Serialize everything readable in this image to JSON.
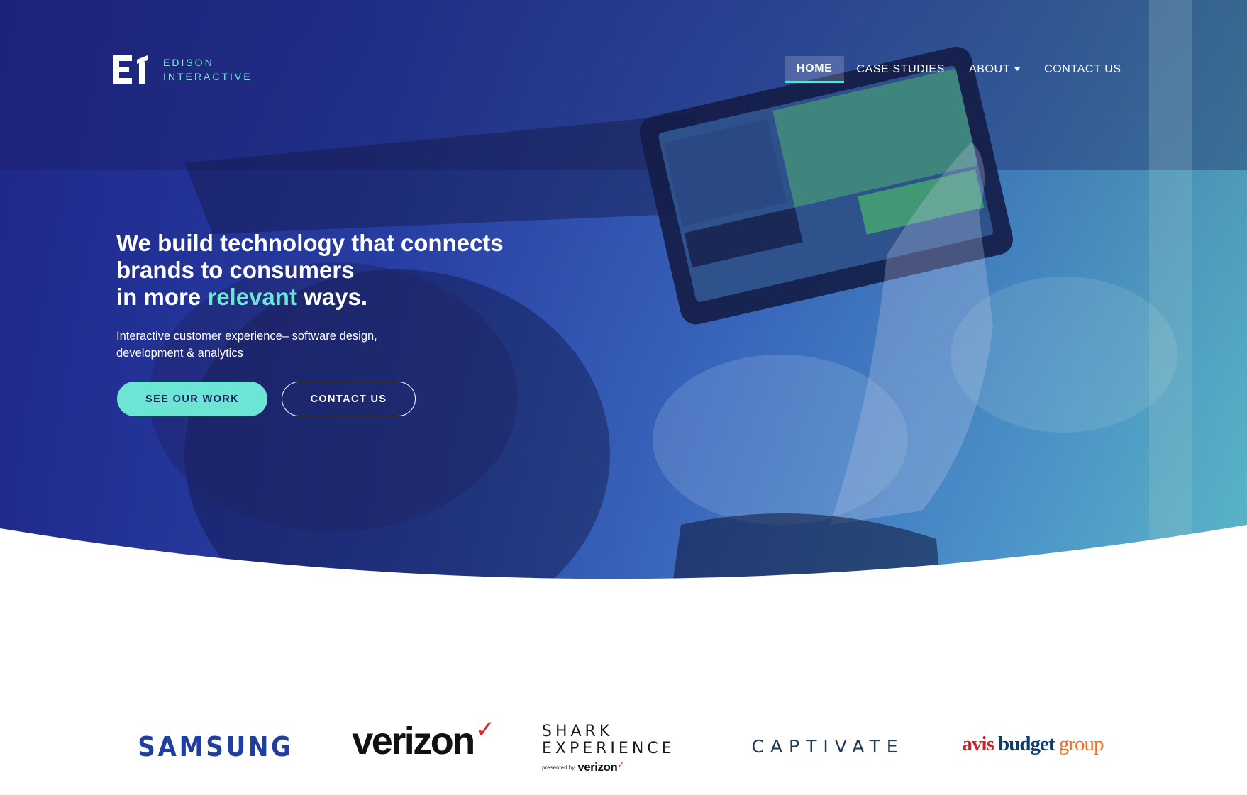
{
  "brand": {
    "name_line1": "EDISON",
    "name_line2": "INTERACTIVE",
    "colors": {
      "navy": "#1e268c",
      "teal": "#6de5d5",
      "white": "#ffffff"
    }
  },
  "nav": {
    "items": [
      {
        "label": "HOME",
        "active": true
      },
      {
        "label": "CASE STUDIES",
        "active": false
      },
      {
        "label": "ABOUT",
        "active": false,
        "has_dropdown": true
      },
      {
        "label": "CONTACT US",
        "active": false
      }
    ]
  },
  "hero": {
    "headline_line1": "We build technology that connects",
    "headline_line2": "brands to consumers",
    "headline_line3_pre": "in more ",
    "headline_line3_accent": "relevant",
    "headline_line3_post": " ways.",
    "subtext": "Interactive customer experience– software design, development & analytics",
    "primary_button": "SEE OUR WORK",
    "secondary_button": "CONTACT US"
  },
  "clients": {
    "samsung": "SAMSUNG",
    "verizon": "verizon",
    "verizon_check": "✓",
    "shark_line1": "SHARK",
    "shark_line2": "EXPERIENCE",
    "shark_presented": "presented by",
    "shark_verizon": "verizon",
    "captivate": "CAPTIVATE",
    "avis_1": "avis",
    "avis_2": "budget",
    "avis_3": "group"
  },
  "icons": [
    "logo-mark-icon",
    "dropdown-caret-icon"
  ]
}
